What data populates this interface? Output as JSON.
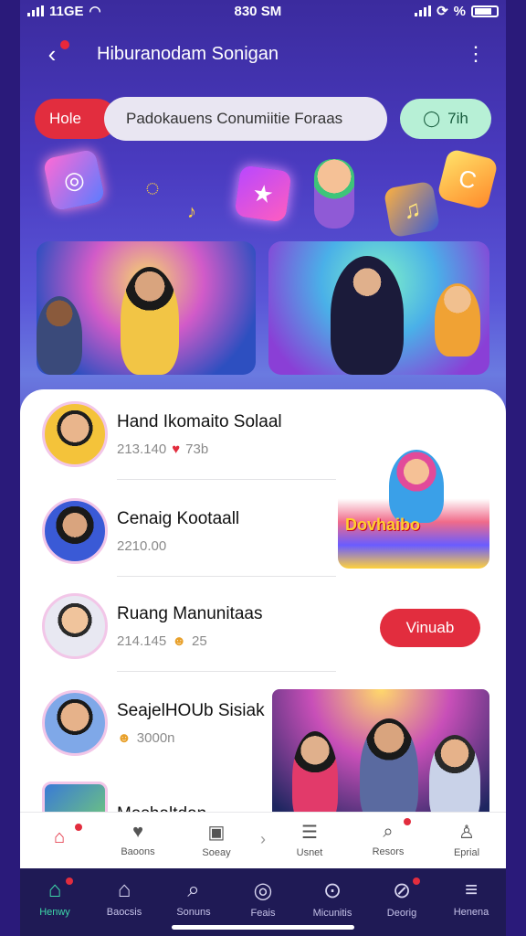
{
  "status": {
    "left_text": "11GE",
    "time": "830 SM",
    "right_text": "%"
  },
  "header": {
    "title": "Hiburanodam Sonigan",
    "back_icon": "chevron-left-icon",
    "more_icon": "more-vertical-icon"
  },
  "pills": {
    "red_label": "Hole",
    "search_text": "Padokauens Conumiitie Foraas",
    "green_label": "7ih"
  },
  "list": [
    {
      "name": "Hand Ikomaito Solaal",
      "meta": "213.140",
      "meta2": "73b"
    },
    {
      "name": "Cenaig Kootaall",
      "meta": "2210.00",
      "meta2": ""
    },
    {
      "name": "Ruang Manunitaas",
      "meta": "214.145",
      "meta2": "25"
    },
    {
      "name": "SeajelHOUb Sisiak",
      "meta": "3000n",
      "meta2": ""
    },
    {
      "name": "Mashaltdan",
      "meta": "",
      "meta2": ""
    }
  ],
  "promo": {
    "label": "Dovhaibo"
  },
  "cta": {
    "label": "Vinuab"
  },
  "tabbar": [
    {
      "label": "",
      "icon": "home-icon"
    },
    {
      "label": "Baoons",
      "icon": "heart-icon"
    },
    {
      "label": "Soeay",
      "icon": "info-icon"
    },
    {
      "label": "Usnet",
      "icon": "list-icon"
    },
    {
      "label": "Resors",
      "icon": "search-icon"
    },
    {
      "label": "Eprial",
      "icon": "user-icon"
    }
  ],
  "navbar": [
    {
      "label": "Henwy",
      "icon": "home-icon"
    },
    {
      "label": "Baocsis",
      "icon": "building-icon"
    },
    {
      "label": "Sonuns",
      "icon": "search-icon"
    },
    {
      "label": "Feais",
      "icon": "compass-icon"
    },
    {
      "label": "Micunitis",
      "icon": "zoom-icon"
    },
    {
      "label": "Deorig",
      "icon": "trend-icon"
    },
    {
      "label": "Henena",
      "icon": "menu-icon"
    }
  ]
}
